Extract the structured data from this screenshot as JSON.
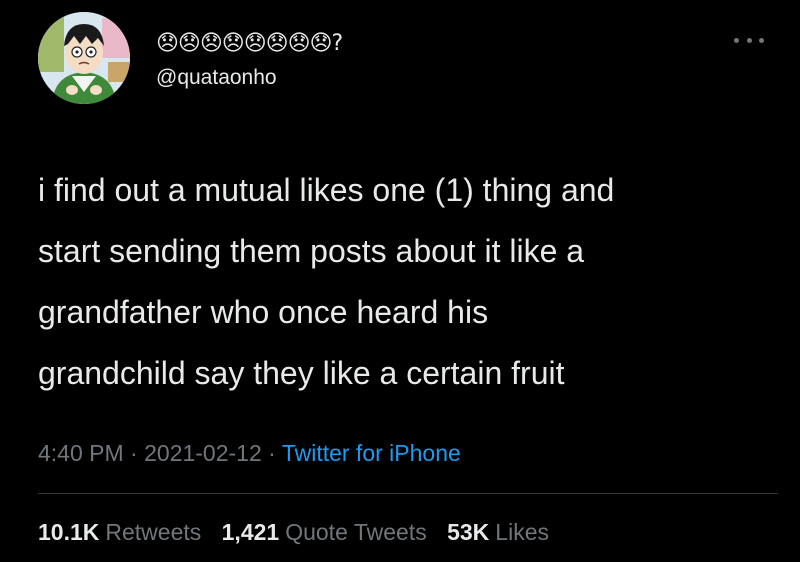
{
  "author": {
    "display_name": "😞😞😞😞😞😞😞😞?",
    "handle": "@quataonho",
    "avatar_icon": "avatar-image"
  },
  "more_icon": "more-options-icon",
  "tweet": {
    "lines": [
      "i find out a mutual likes one (1) thing and",
      "start sending them posts about it like a",
      "grandfather who once heard his",
      "grandchild say they like a certain fruit"
    ]
  },
  "meta": {
    "time": "4:40 PM",
    "separator": "·",
    "date": "2021-02-12",
    "source": "Twitter for iPhone"
  },
  "stats": {
    "retweets": {
      "count": "10.1K",
      "label": "Retweets"
    },
    "quote_tweets": {
      "count": "1,421",
      "label": "Quote Tweets"
    },
    "likes": {
      "count": "53K",
      "label": "Likes"
    }
  },
  "colors": {
    "background": "#000000",
    "primary_text": "#e7e9ea",
    "secondary_text": "#71767b",
    "link": "#1d9bf0",
    "divider": "#2f3336"
  }
}
